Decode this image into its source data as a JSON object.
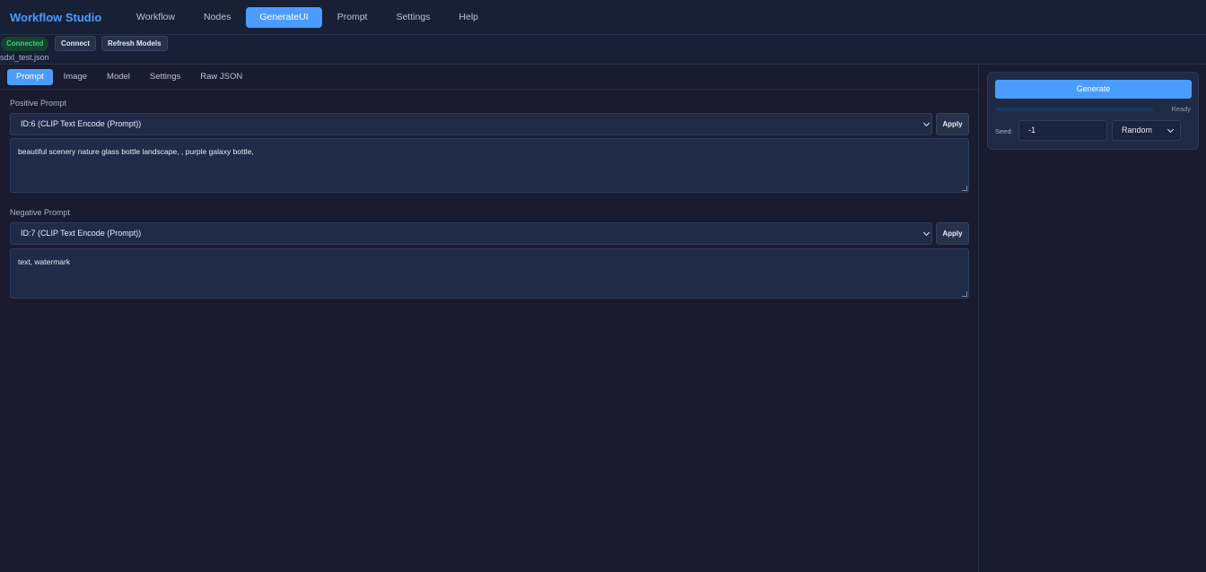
{
  "app": {
    "title": "Workflow Studio"
  },
  "nav": {
    "items": [
      {
        "label": "Workflow",
        "active": false
      },
      {
        "label": "Nodes",
        "active": false
      },
      {
        "label": "GenerateUI",
        "active": true
      },
      {
        "label": "Prompt",
        "active": false
      },
      {
        "label": "Settings",
        "active": false
      },
      {
        "label": "Help",
        "active": false
      }
    ]
  },
  "status": {
    "connection": "Connected",
    "connect_label": "Connect",
    "refresh_label": "Refresh Models",
    "filename": "sdxl_test.json"
  },
  "tabs": [
    {
      "label": "Prompt",
      "active": true
    },
    {
      "label": "Image",
      "active": false
    },
    {
      "label": "Model",
      "active": false
    },
    {
      "label": "Settings",
      "active": false
    },
    {
      "label": "Raw JSON",
      "active": false
    }
  ],
  "positive": {
    "label": "Positive Prompt",
    "node": "ID:6 (CLIP Text Encode (Prompt))",
    "apply_label": "Apply",
    "text": "beautiful scenery nature glass bottle landscape, , purple galaxy bottle,"
  },
  "negative": {
    "label": "Negative Prompt",
    "node": "ID:7 (CLIP Text Encode (Prompt))",
    "apply_label": "Apply",
    "text": "text, watermark"
  },
  "generate": {
    "button_label": "Generate",
    "status": "Ready",
    "progress": 0,
    "seed_label": "Seed:",
    "seed_value": "-1",
    "seed_mode": "Random"
  },
  "colors": {
    "accent": "#4a9dff",
    "background": "#1a1b2e",
    "connected": "#35d27a"
  }
}
